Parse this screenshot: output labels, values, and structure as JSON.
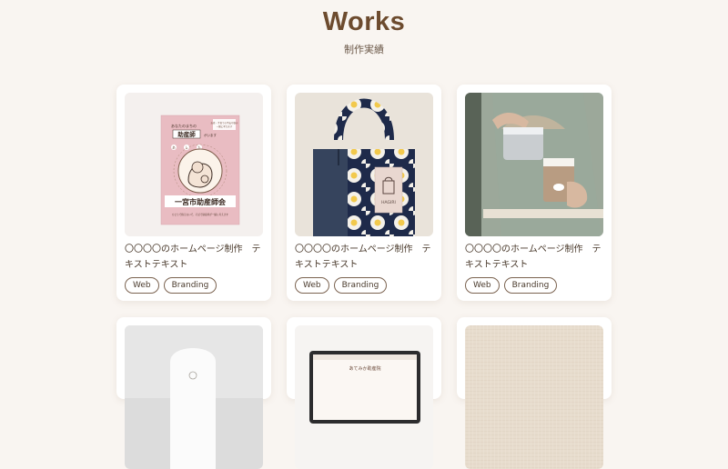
{
  "header": {
    "title": "Works",
    "subtitle": "制作実績"
  },
  "works": [
    {
      "title": "〇〇〇〇のホームページ制作　テキストテキスト",
      "tags": [
        "Web",
        "Branding"
      ],
      "image": {
        "kind": "booklet",
        "top_note": "あなたのまちの",
        "highlight": "助産師",
        "highlight_suffix": "がいます",
        "corner_note_1": "お産・子育ての不安や悩み",
        "corner_note_2": "一緒に考えます",
        "org_name": "一宮市助産師会",
        "footer_note": "ひとりで抱えないで、そばで助産師が一緒に考えます",
        "stamp_1": "あ",
        "stamp_2": "し",
        "stamp_3": "た"
      }
    },
    {
      "title": "〇〇〇〇のホームページ制作　テキストテキスト",
      "tags": [
        "Web",
        "Branding"
      ],
      "image": {
        "kind": "tote",
        "label": "HAGIRI"
      }
    },
    {
      "title": "〇〇〇〇のホームページ制作　テキストテキスト",
      "tags": [
        "Web",
        "Branding"
      ],
      "image": {
        "kind": "barista"
      }
    },
    {
      "image": {
        "kind": "tube"
      }
    },
    {
      "image": {
        "kind": "laptop",
        "screen_text": "あてみか助産院"
      }
    },
    {
      "image": {
        "kind": "linen"
      }
    }
  ]
}
